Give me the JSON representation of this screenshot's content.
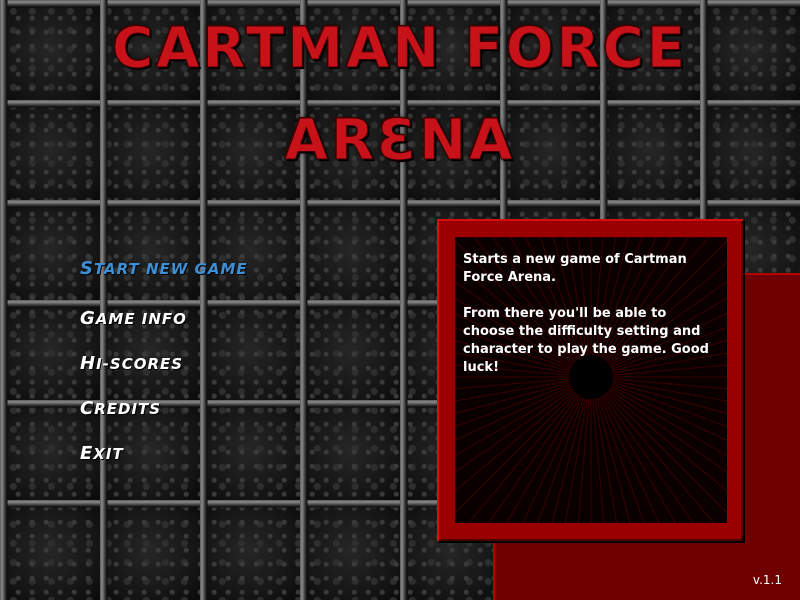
{
  "title": {
    "line1": "CARTMAN FORCE",
    "line2": "ARƐNA"
  },
  "menu": {
    "items": [
      {
        "cap": "S",
        "rest": "TART NEW GAME",
        "active": true
      },
      {
        "cap": "G",
        "rest": "AME INFO",
        "active": false
      },
      {
        "cap": "H",
        "rest": "I-SCORES",
        "active": false
      },
      {
        "cap": "C",
        "rest": "REDITS",
        "active": false
      },
      {
        "cap": "E",
        "rest": "XIT",
        "active": false
      }
    ]
  },
  "description": {
    "paragraph1": "Starts a new game of Cartman Force Arena.",
    "paragraph2": "From there you'll be able to choose the difficulty setting and character to play the game. Good luck!"
  },
  "version": "v.1.1",
  "colors": {
    "title_red": "#c8121a",
    "active_item": "#3d8fd6",
    "panel_red": "#9a0000"
  }
}
